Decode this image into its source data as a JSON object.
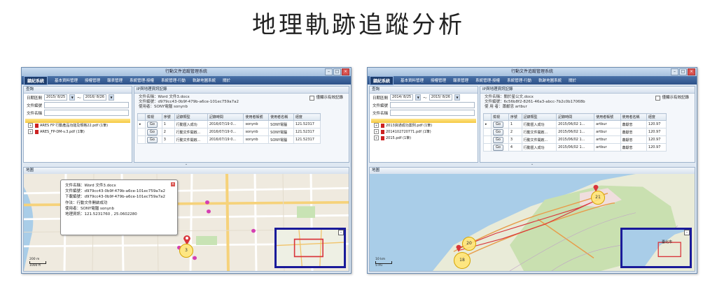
{
  "slide": {
    "title": "地理軌跡追蹤分析"
  },
  "left_window": {
    "window_title": "行動文件追蹤管理系統",
    "menu_logo": "鎮紀系統",
    "menu": [
      "基本資料管理",
      "授權管理",
      "報表管理",
      "系統管理-授權",
      "系統管理-行動",
      "軌跡地圖系統",
      "關於"
    ],
    "query": {
      "header": "查詢",
      "date_label": "日期區間",
      "date_from": "2015/ 8/25",
      "date_sep": "～",
      "date_to": "2016/ 8/26",
      "doc_id_label": "文件編號",
      "doc_name_label": "文件名稱",
      "tree_items": [
        "ARES FP 行動產品功能及規格22.pdf (1筆)",
        "ARES_FP-DM-v.3.pdf (1筆)"
      ]
    },
    "ip": {
      "header": "IP與地理資訊記錄",
      "doc_name_line": "文件名稱：Word 文件3.docx",
      "doc_id_line": "文件編號：d979cc43-0b9f-479b-a6ce-101ec759a7a2",
      "user_line": "使用者：SONY電腦 sonynb",
      "show_all_label": "僅顯示有效記錄",
      "columns": [
        "檢視",
        "序號",
        "記錄類型",
        "記錄時間",
        "使用者帳號",
        "使用者名稱",
        "經度"
      ],
      "rows": [
        {
          "btn": "Go",
          "no": "1",
          "type": "行動匯入成功",
          "time": "2016/07/19 0...",
          "acct": "sonynb",
          "name": "SONY電腦",
          "lon": "121.52317"
        },
        {
          "btn": "Go",
          "no": "2",
          "type": "行動文件開啟...",
          "time": "2016/07/19 0...",
          "acct": "sonynb",
          "name": "SONY電腦",
          "lon": "121.52317"
        },
        {
          "btn": "Go",
          "no": "3",
          "type": "行動文件開啟...",
          "time": "2016/07/19 0...",
          "acct": "sonynb",
          "name": "SONY電腦",
          "lon": "121.52317"
        }
      ]
    },
    "map": {
      "header": "地圖",
      "popup_lines": [
        "文件名稱：Word 文件3.docx",
        "文件編號：d979cc43-0b9f-479b-a6ce-101ec759a7a2",
        "下載編號：d979cc43-0b9f-479b-a6ce-101ec759a7a2",
        "作法：行動文件開啟成功",
        "使用者：SONY電腦 sonynb",
        "地理資訊：121.5231760 , 25.0602280"
      ],
      "cluster_label": "3",
      "scale_top": "200 m",
      "scale_bottom": "1000 ft"
    }
  },
  "right_window": {
    "window_title": "行動文件追蹤管理系統",
    "menu_logo": "鎮紀系統",
    "menu": [
      "基本資料管理",
      "授權管理",
      "報表管理",
      "系統管理-授權",
      "系統管理-行動",
      "軌跡地圖系統",
      "關於"
    ],
    "query": {
      "header": "查詢",
      "date_label": "日期區間",
      "date_from": "2014/ 8/25",
      "date_sep": "～",
      "date_to": "2015/ 8/26",
      "doc_id_label": "文件編號",
      "doc_name_label": "文件名稱",
      "tree_items": [
        "2013資通成功案例.pdf (1筆)",
        "2014102720771.pdf (1筆)",
        "2015.pdf (1筆)"
      ]
    },
    "ip": {
      "header": "IP與地理資訊記錄",
      "doc_name_line": "文件名稱：關於星公文.docx",
      "doc_id_line": "文件編號：6c56b8f2-8261-46a3-abcc-7b2c0b17068b",
      "user_line": "使 用 者：蕭獻忠 artbur",
      "show_all_label": "僅顯示有效記錄",
      "columns": [
        "檢視",
        "序號",
        "記錄類型",
        "記錄時間",
        "使用者帳號",
        "使用者名稱",
        "經度"
      ],
      "rows": [
        {
          "btn": "Go",
          "no": "1",
          "type": "行動匯入成功",
          "time": "2015/06/02 1...",
          "acct": "artbur",
          "name": "蕭獻忠",
          "lon": "120.97"
        },
        {
          "btn": "Go",
          "no": "2",
          "type": "行動文件開啟...",
          "time": "2015/06/02 1...",
          "acct": "artbur",
          "name": "蕭獻忠",
          "lon": "120.97"
        },
        {
          "btn": "Go",
          "no": "3",
          "type": "行動文件開啟...",
          "time": "2015/06/02 1...",
          "acct": "artbur",
          "name": "蕭獻忠",
          "lon": "120.97"
        },
        {
          "btn": "Go",
          "no": "4",
          "type": "行動匯入成功",
          "time": "2015/06/02 1...",
          "acct": "artbur",
          "name": "蕭獻忠",
          "lon": "120.97"
        }
      ]
    },
    "map": {
      "header": "地圖",
      "clusters": [
        "21",
        "20",
        "18"
      ],
      "scale_top": "10 km",
      "scale_bottom": "5 mi",
      "city_label": "臺北市"
    }
  },
  "colors": {
    "menu_bg": "#2d5188",
    "overview_border": "#1a1a9a",
    "cluster_fill": "#ffe678",
    "track_line": "#d9343a"
  }
}
